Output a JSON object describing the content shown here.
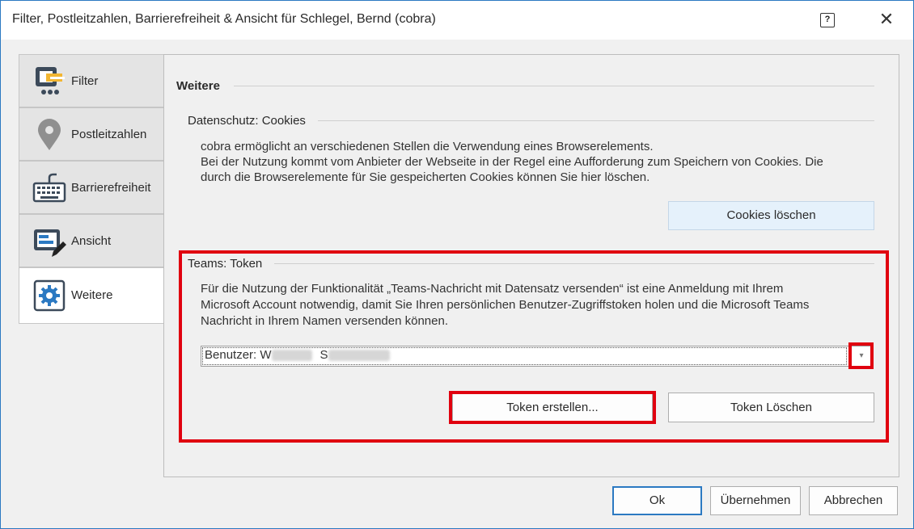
{
  "window": {
    "title": "Filter, Postleitzahlen, Barrierefreiheit & Ansicht für Schlegel, Bernd (cobra)",
    "help_glyph": "?",
    "close_glyph": "✕"
  },
  "tabs": [
    {
      "label": "Filter",
      "icon": "filter-icon"
    },
    {
      "label": "Postleitzahlen",
      "icon": "map-pin-icon"
    },
    {
      "label": "Barrierefreiheit",
      "icon": "keyboard-icon"
    },
    {
      "label": "Ansicht",
      "icon": "view-edit-icon"
    },
    {
      "label": "Weitere",
      "icon": "gear-icon",
      "active": true
    }
  ],
  "section": {
    "title": "Weitere"
  },
  "cookies": {
    "title": "Datenschutz: Cookies",
    "lines": [
      "cobra ermöglicht an verschiedenen Stellen die Verwendung eines Browserelements.",
      "Bei der Nutzung kommt vom Anbieter der Webseite in der Regel eine Aufforderung zum Speichern von Cookies. Die",
      "durch die Browserelemente für Sie gespeicherten Cookies können Sie hier löschen."
    ],
    "button": "Cookies löschen"
  },
  "teams": {
    "title": "Teams: Token",
    "lines": [
      "Für die Nutzung der Funktionalität „Teams-Nachricht mit Datensatz versenden“ ist eine Anmeldung mit Ihrem",
      "Microsoft Account notwendig, damit Sie Ihren persönlichen Benutzer-Zugriffstoken holen und die Microsoft Teams",
      "Nachricht in Ihrem Namen versenden können."
    ],
    "user_label": "Benutzer: W",
    "user_mid": "S",
    "arrow_glyph": "▾",
    "create_button": "Token erstellen...",
    "delete_button": "Token Löschen"
  },
  "footer": {
    "ok": "Ok",
    "apply": "Übernehmen",
    "cancel": "Abbrechen"
  },
  "colors": {
    "highlight": "#e0000f",
    "accent": "#2b79c2"
  }
}
